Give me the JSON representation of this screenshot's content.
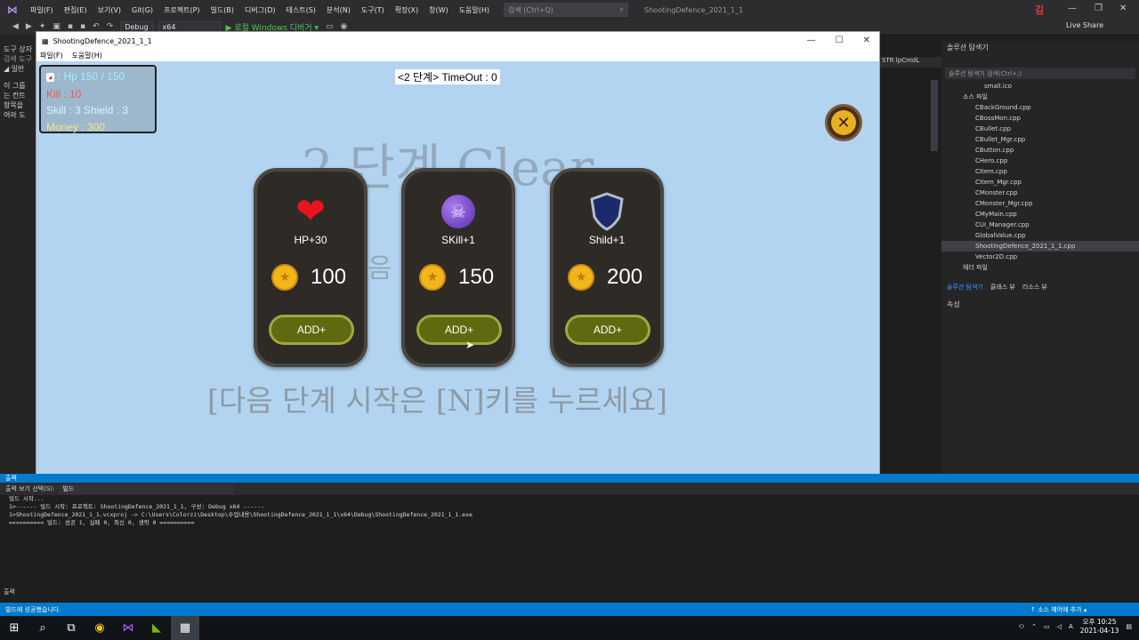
{
  "vs": {
    "menu": [
      "파일(F)",
      "편집(E)",
      "보기(V)",
      "Git(G)",
      "프로젝트(P)",
      "빌드(B)",
      "디버그(D)",
      "테스트(S)",
      "분석(N)",
      "도구(T)",
      "확장(X)",
      "창(W)",
      "도움말(H)"
    ],
    "search_placeholder": "검색 (Ctrl+Q)",
    "solution_title": "ShootingDefence_2021_1_1",
    "user_initial": "김",
    "config": "Debug",
    "platform": "x64",
    "run_label": "▶ 로컬 Windows 디버거 ▾",
    "live_share": "Live Share",
    "left_panel": [
      "도구 상자",
      "검색 도구",
      "◢ 일반",
      "이 그룹",
      "는 컨트",
      "항목을",
      "여와 도"
    ]
  },
  "game": {
    "window_title": "ShootingDefence_2021_1_1",
    "menu": [
      "파일(F)",
      "도움말(H)"
    ],
    "status": {
      "hp": ": Hp 150 / 150",
      "kill": "Kill : 10",
      "skill_shield": "Skill : 3  Shield : 3",
      "money": "Money : 300"
    },
    "timeout": "<2 단계> TimeOut : 0",
    "bg_title": "2 단계 Clear",
    "bg_sub": "음 단계",
    "next_stage_msg": "[다음 단계 시작은 [N]키를 누르세요]",
    "cards": [
      {
        "label": "HP+30",
        "price": "100",
        "button": "ADD+",
        "icon": "heart-icon",
        "color": "#e8161c"
      },
      {
        "label": "SKill+1",
        "price": "150",
        "button": "ADD+",
        "icon": "skull-bomb-icon",
        "color": "#7d3fd6"
      },
      {
        "label": "Shild+1",
        "price": "200",
        "button": "ADD+",
        "icon": "shield-icon",
        "color": "#1b2a6a"
      }
    ]
  },
  "solution_explorer": {
    "title": "솔루션 탐색기",
    "search_placeholder": "솔루션 탐색기 검색(Ctrl+;)",
    "items": [
      "small.ico",
      "소스 파일",
      "CBackGround.cpp",
      "CBossMon.cpp",
      "CBullet.cpp",
      "CBullet_Mgr.cpp",
      "CButton.cpp",
      "CHero.cpp",
      "CItem.cpp",
      "CItem_Mgr.cpp",
      "CMonster.cpp",
      "CMonster_Mgr.cpp",
      "CMyMain.cpp",
      "CUI_Manager.cpp",
      "GlobalValue.cpp",
      "ShootingDefence_2021_1_1.cpp",
      "Vector2D.cpp",
      "헤더 파일"
    ],
    "selected": "ShootingDefence_2021_1_1.cpp",
    "tabs": [
      "솔루션 탐색기",
      "클래스 뷰",
      "리소스 뷰"
    ],
    "properties": "속성",
    "editor_combo": "STR lpCmdL"
  },
  "output": {
    "title": "출력",
    "source_label": "출력 보기 선택(S):",
    "source_value": "빌드",
    "lines": [
      "빌드 시작...",
      "1>------ 빌드 시작: 프로젝트: ShootingDefence_2021_1_1, 구성: Debug x64 ------",
      "1>ShootingDefence_2021_1_1.vcxproj -> C:\\Users\\Colorzi\\Desktop\\수업내용\\ShootingDefence_2021_1_1\\x64\\Debug\\ShootingDefence_2021_1_1.exe",
      "========== 빌드: 성공 1, 실패 0, 최신 0, 생략 0 =========="
    ],
    "footer": "출력"
  },
  "status_bar": {
    "left": "빌드에 성공했습니다.",
    "right": "↑ 소스 제어에 추가 ▴"
  },
  "taskbar": {
    "time": "오후 10:25",
    "date": "2021-04-13",
    "lang": "A"
  }
}
